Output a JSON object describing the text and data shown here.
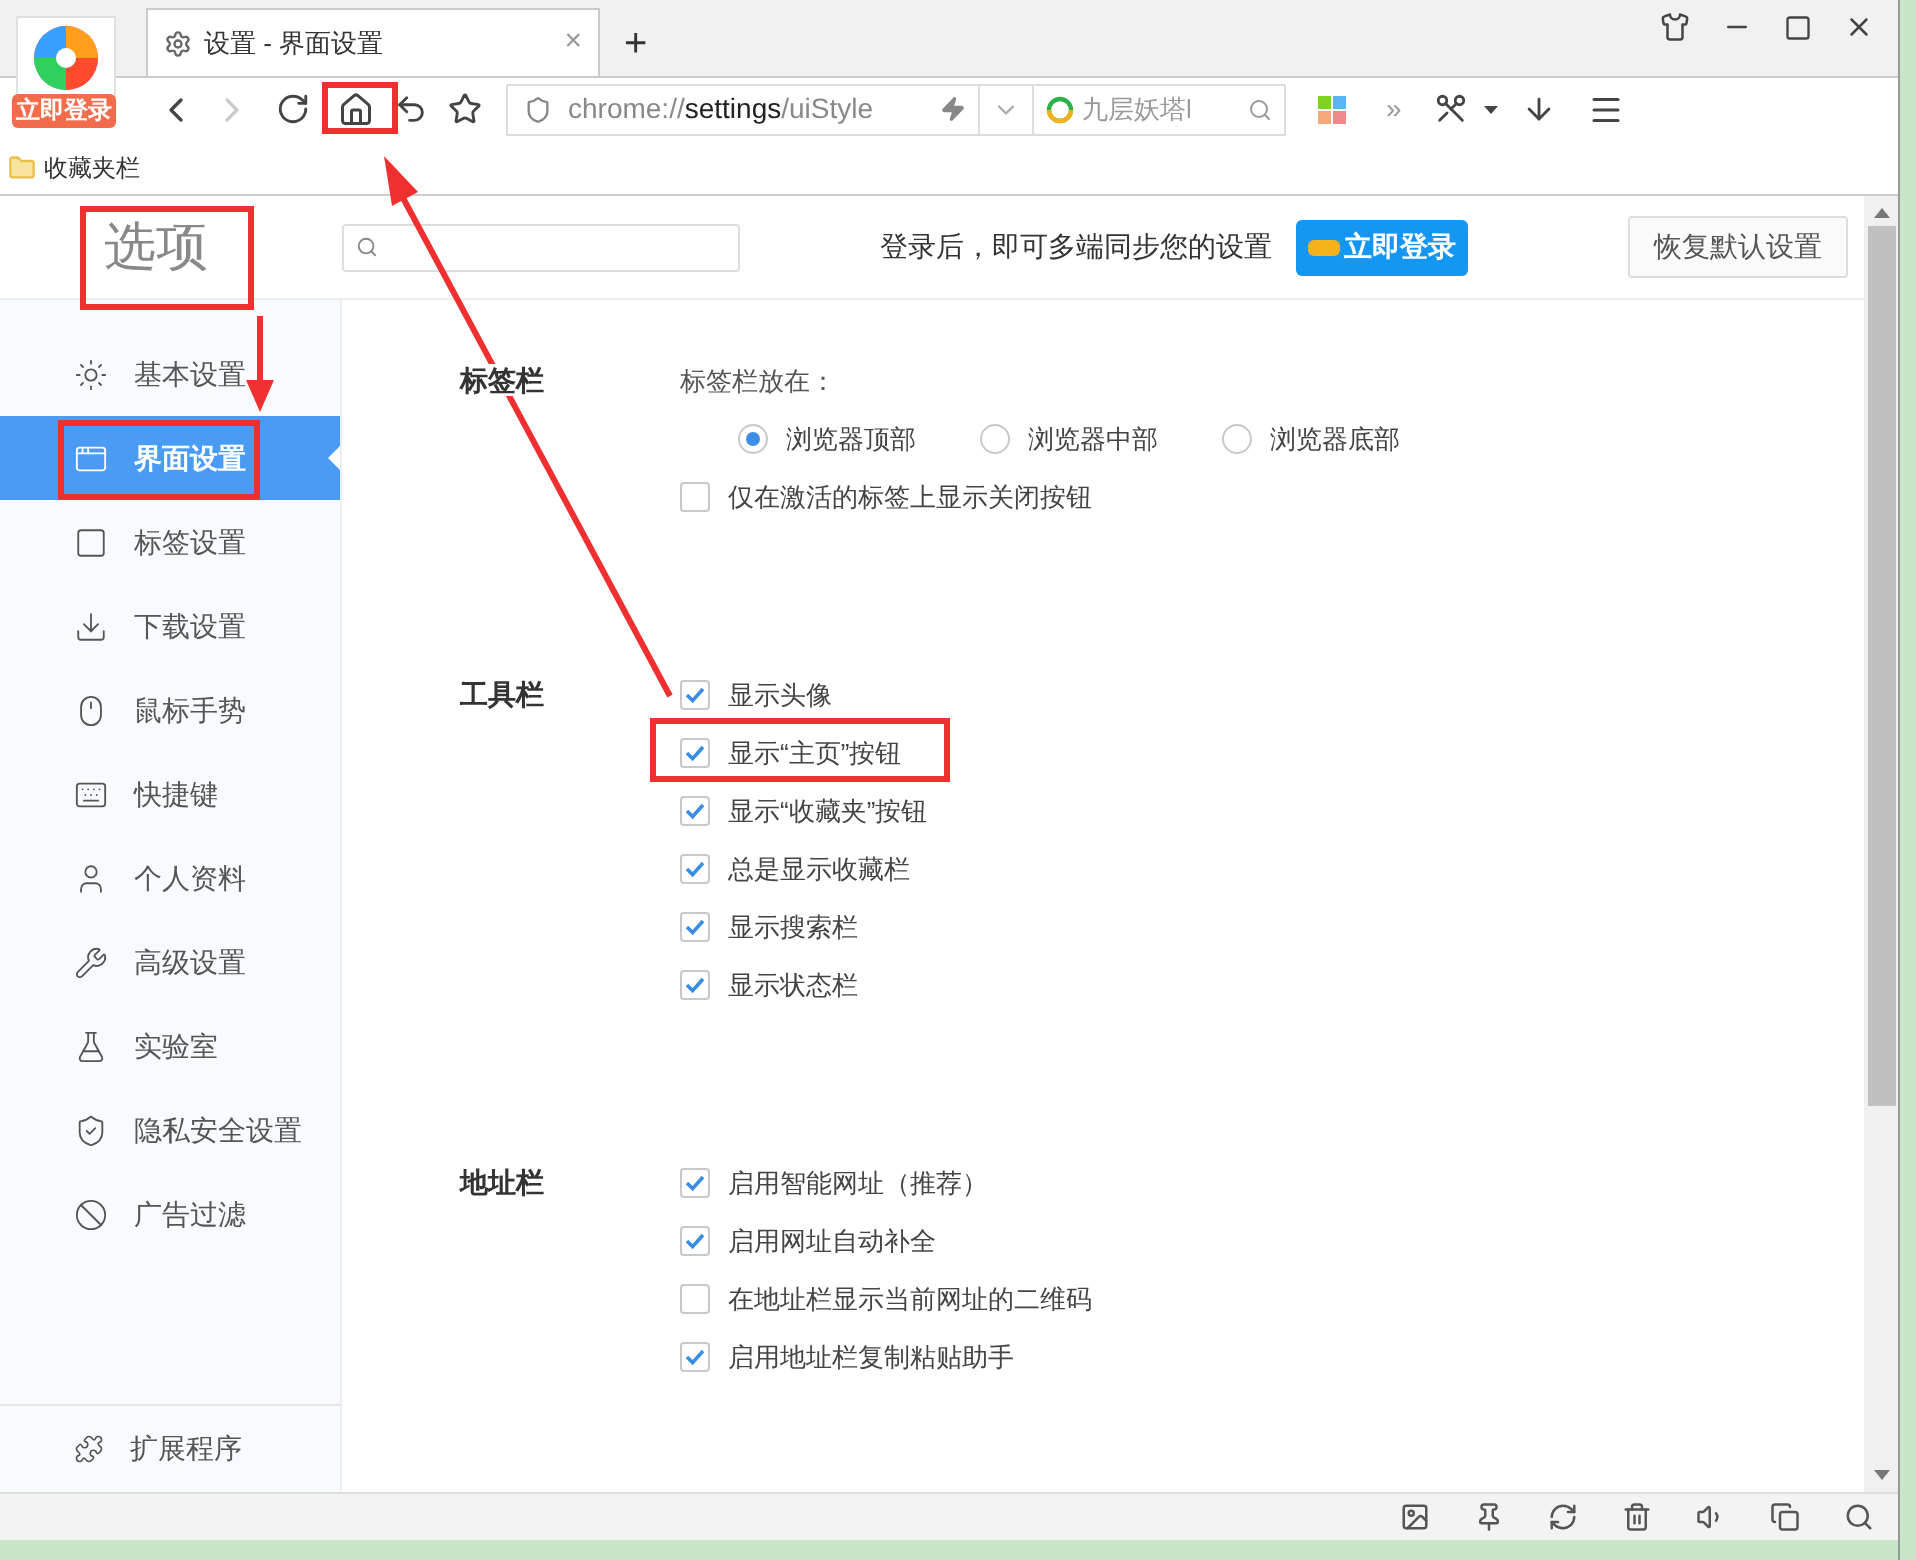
{
  "browser": {
    "login_badge": "立即登录",
    "tab": {
      "title": "设置 - 界面设置",
      "close": "×"
    },
    "new_tab": "+",
    "address": {
      "scheme": "chrome://",
      "host": "settings",
      "path": "/uiStyle"
    },
    "search_box": {
      "value": "九层妖塔l"
    },
    "more": "»",
    "bookmarks": [
      {
        "label": "收藏夹栏"
      }
    ]
  },
  "settings": {
    "title": "选项",
    "sync_text": "登录后，即可多端同步您的设置",
    "login_button": "立即登录",
    "reset_button": "恢复默认设置",
    "sidebar": [
      {
        "label": "基本设置",
        "selected": false
      },
      {
        "label": "界面设置",
        "selected": true
      },
      {
        "label": "标签设置",
        "selected": false
      },
      {
        "label": "下载设置",
        "selected": false
      },
      {
        "label": "鼠标手势",
        "selected": false
      },
      {
        "label": "快捷键",
        "selected": false
      },
      {
        "label": "个人资料",
        "selected": false
      },
      {
        "label": "高级设置",
        "selected": false
      },
      {
        "label": "实验室",
        "selected": false
      },
      {
        "label": "隐私安全设置",
        "selected": false
      },
      {
        "label": "广告过滤",
        "selected": false
      }
    ],
    "sidebar_footer": "扩展程序",
    "sections": [
      {
        "title": "标签栏",
        "options": [
          {
            "kind": "caption",
            "label": "标签栏放在："
          },
          {
            "kind": "radio_group",
            "options": [
              {
                "label": "浏览器顶部",
                "selected": true
              },
              {
                "label": "浏览器中部",
                "selected": false
              },
              {
                "label": "浏览器底部",
                "selected": false
              }
            ]
          },
          {
            "kind": "checkbox",
            "label": "仅在激活的标签上显示关闭按钮",
            "checked": false
          }
        ]
      },
      {
        "title": "工具栏",
        "options": [
          {
            "kind": "checkbox",
            "label": "显示头像",
            "checked": true
          },
          {
            "kind": "checkbox",
            "label": "显示“主页”按钮",
            "checked": true
          },
          {
            "kind": "checkbox",
            "label": "显示“收藏夹”按钮",
            "checked": true
          },
          {
            "kind": "checkbox",
            "label": "总是显示收藏栏",
            "checked": true
          },
          {
            "kind": "checkbox",
            "label": "显示搜索栏",
            "checked": true
          },
          {
            "kind": "checkbox",
            "label": "显示状态栏",
            "checked": true
          }
        ]
      },
      {
        "title": "地址栏",
        "options": [
          {
            "kind": "checkbox",
            "label": "启用智能网址（推荐）",
            "checked": true
          },
          {
            "kind": "checkbox",
            "label": "启用网址自动补全",
            "checked": true
          },
          {
            "kind": "checkbox",
            "label": "在地址栏显示当前网址的二维码",
            "checked": false
          },
          {
            "kind": "checkbox",
            "label": "启用地址栏复制粘贴助手",
            "checked": true
          }
        ]
      }
    ]
  }
}
